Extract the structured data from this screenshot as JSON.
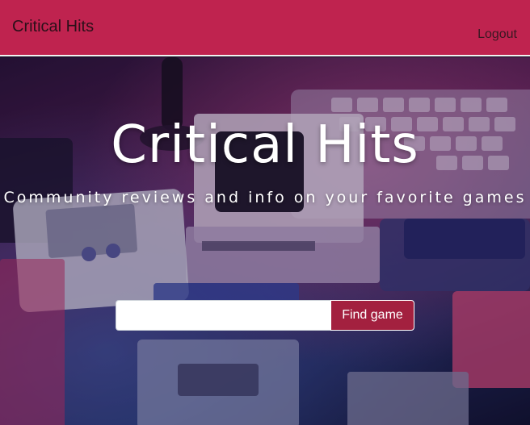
{
  "navbar": {
    "brand": "Critical Hits",
    "logout_label": "Logout"
  },
  "hero": {
    "title": "Critical Hits",
    "subtitle": "Community reviews and info on your favorite games"
  },
  "search": {
    "value": "",
    "placeholder": "",
    "button_label": "Find game"
  },
  "colors": {
    "navbar_bg": "#bf234f",
    "button_bg": "#a3203f"
  }
}
